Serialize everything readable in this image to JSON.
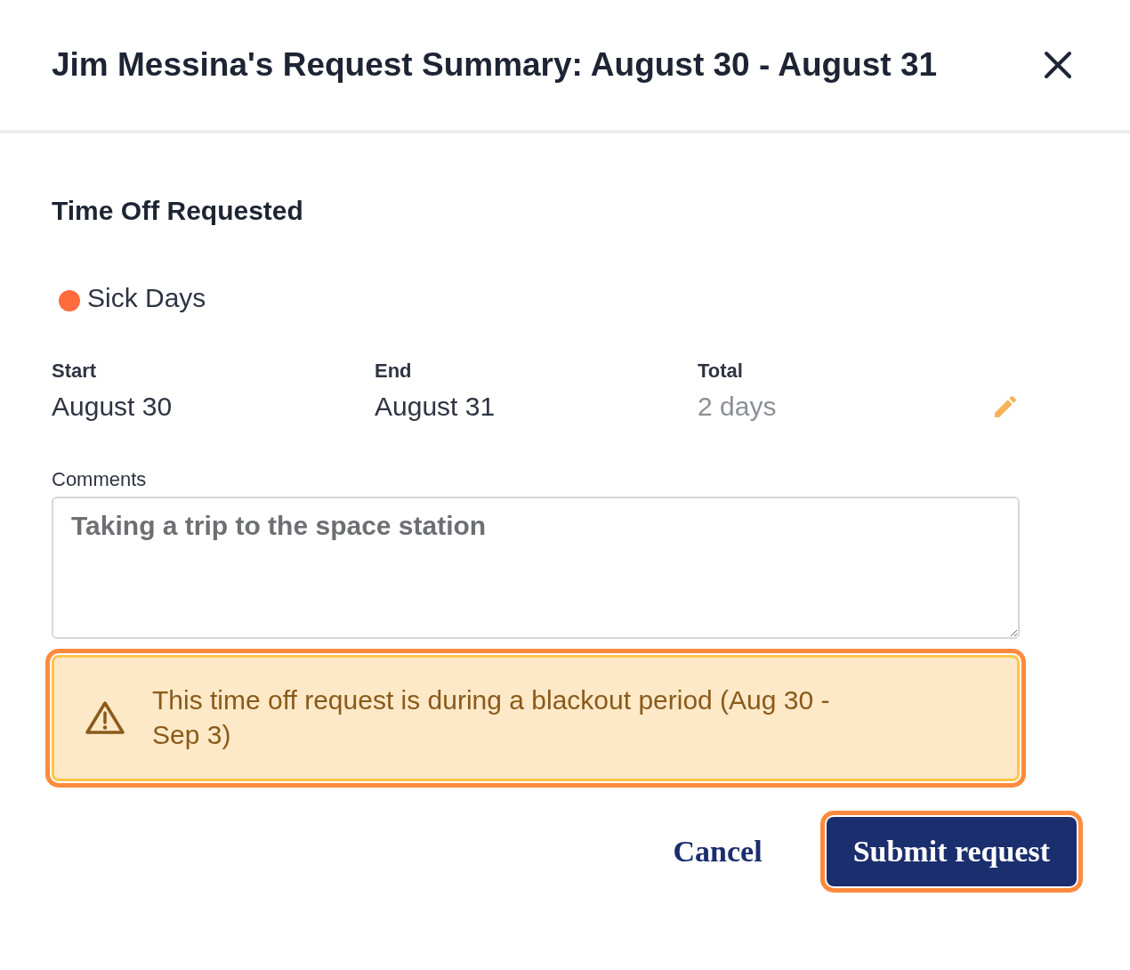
{
  "dialog": {
    "title": "Jim Messina's Request Summary: August 30 - August 31"
  },
  "section_title": "Time Off Requested",
  "leave_type": {
    "label": "Sick Days",
    "color": "#ff6b3d"
  },
  "fields": [
    {
      "label": "Start",
      "value": "August 30",
      "muted": false
    },
    {
      "label": "End",
      "value": "August 31",
      "muted": false
    },
    {
      "label": "Total",
      "value": "2 days",
      "muted": true
    }
  ],
  "comments": {
    "label": "Comments",
    "value": "Taking a trip to the space station"
  },
  "warning": {
    "text": "This time off request is during a blackout period (Aug 30 - Sep 3)",
    "highlighted": true
  },
  "buttons": [
    {
      "label": "Cancel",
      "kind": "secondary",
      "highlighted": false
    },
    {
      "label": "Submit request",
      "kind": "primary",
      "highlighted": true
    }
  ]
}
